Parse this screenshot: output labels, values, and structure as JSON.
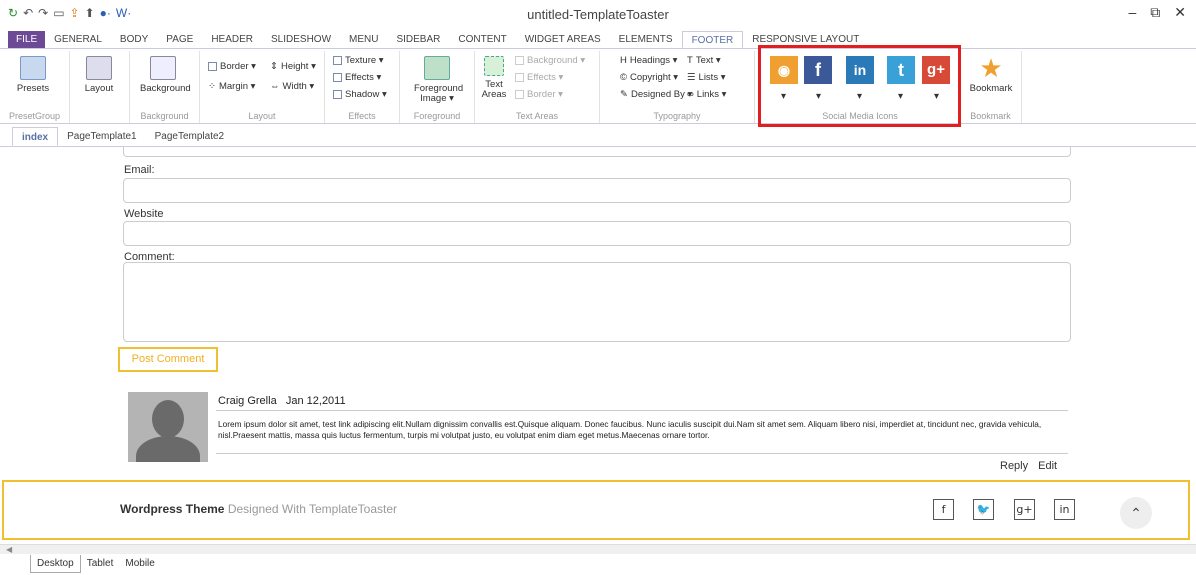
{
  "window": {
    "title": "untitled-TemplateToaster",
    "min": "–",
    "restore": "⧉",
    "close": "✕"
  },
  "qat": [
    "↻",
    "↶",
    "↷",
    "▭",
    "⇪",
    "⬆",
    "●·",
    "W·"
  ],
  "tabs": [
    "FILE",
    "GENERAL",
    "BODY",
    "PAGE",
    "HEADER",
    "SLIDESHOW",
    "MENU",
    "SIDEBAR",
    "CONTENT",
    "WIDGET AREAS",
    "ELEMENTS",
    "FOOTER",
    "RESPONSIVE LAYOUT"
  ],
  "active_tab": "FOOTER",
  "ribbon": {
    "presets": "Presets",
    "layout": "Layout",
    "background": "Background",
    "foreground_image": "Foreground Image ▾",
    "text_areas": "Text Areas",
    "border": "Border ▾",
    "height": "Height ▾",
    "margin": "Margin ▾",
    "width": "Width ▾",
    "texture": "Texture ▾",
    "effects": "Effects ▾",
    "shadow": "Shadow ▾",
    "bg_disabled": "Background ▾",
    "effects_disabled": "Effects ▾",
    "border_disabled": "Border ▾",
    "headings": "Headings ▾",
    "text": "Text ▾",
    "copyright": "Copyright ▾",
    "lists": "Lists ▾",
    "designed_by": "Designed By ▾",
    "links": "Links ▾",
    "bookmark": "Bookmark",
    "groups": {
      "preset": "PresetGroup",
      "background": "Background",
      "layout": "Layout",
      "effects": "Effects",
      "foreground": "Foreground",
      "text_areas": "Text Areas",
      "typography": "Typography",
      "social": "Social Media Icons",
      "bookmark": "Bookmark"
    },
    "social_icons": [
      {
        "name": "rss",
        "glyph": "◉",
        "color": "#f0a030"
      },
      {
        "name": "facebook",
        "glyph": "f",
        "color": "#3b5998"
      },
      {
        "name": "linkedin",
        "glyph": "in",
        "color": "#2a7ab8"
      },
      {
        "name": "twitter",
        "glyph": "t",
        "color": "#3aa0d8"
      },
      {
        "name": "google-plus",
        "glyph": "g+",
        "color": "#d84a38"
      }
    ]
  },
  "page_tabs": [
    "index",
    "PageTemplate1",
    "PageTemplate2"
  ],
  "form": {
    "email_label": "Email:",
    "website_label": "Website",
    "comment_label": "Comment:",
    "post_button": "Post Comment"
  },
  "comment": {
    "author": "Craig Grella",
    "date": "Jan 12,2011",
    "text": "Lorem ipsum dolor sit amet, test link adipiscing elit.Nullam dignissim convallis est.Quisque aliquam. Donec faucibus. Nunc iaculis suscipit dui.Nam sit amet sem. Aliquam libero nisi, imperdiet at, tincidunt nec, gravida vehicula, nisl.Praesent mattis, massa quis luctus fermentum, turpis mi volutpat justo, eu volutpat enim diam eget metus.Maecenas ornare tortor.",
    "reply": "Reply",
    "edit": "Edit"
  },
  "footer": {
    "brand": "Wordpress Theme",
    "tagline": "Designed With TemplateToaster",
    "social": [
      "f",
      "🐦",
      "g+",
      "in"
    ],
    "top": "⌃"
  },
  "view_tabs": [
    "Desktop",
    "Tablet",
    "Mobile"
  ]
}
